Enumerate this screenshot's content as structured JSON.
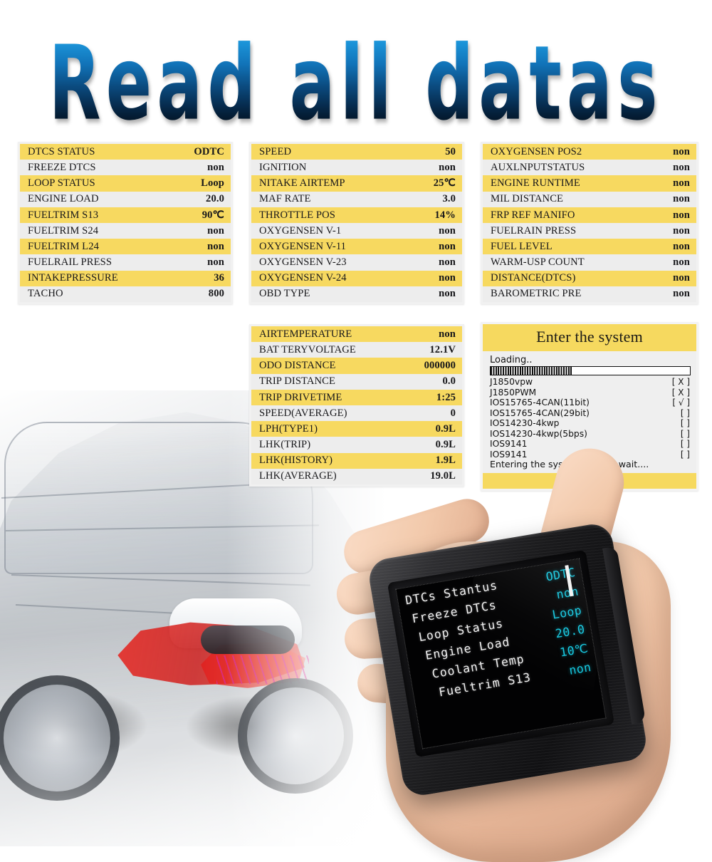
{
  "title": "Read all datas",
  "tables": [
    {
      "id": "table-1",
      "rows": [
        {
          "k": "DTCS STATUS",
          "v": "ODTC"
        },
        {
          "k": "FREEZE DTCS",
          "v": "non"
        },
        {
          "k": "LOOP STATUS",
          "v": "Loop"
        },
        {
          "k": "ENGINE LOAD",
          "v": "20.0"
        },
        {
          "k": "FUELTRIM S13",
          "v": "90℃"
        },
        {
          "k": "FUELTRIM S24",
          "v": "non"
        },
        {
          "k": "FUELTRIM L24",
          "v": "non"
        },
        {
          "k": "FUELRAIL PRESS",
          "v": "non"
        },
        {
          "k": "INTAKEPRESSURE",
          "v": "36"
        },
        {
          "k": "TACHO",
          "v": "800"
        }
      ]
    },
    {
      "id": "table-2",
      "rows": [
        {
          "k": "SPEED",
          "v": "50"
        },
        {
          "k": "IGNITION",
          "v": "non"
        },
        {
          "k": "NITAKE AIRTEMP",
          "v": "25℃"
        },
        {
          "k": "MAF RATE",
          "v": "3.0"
        },
        {
          "k": "THROTTLE POS",
          "v": "14%"
        },
        {
          "k": "OXYGENSEN V-1",
          "v": "non"
        },
        {
          "k": "OXYGENSEN V-11",
          "v": "non"
        },
        {
          "k": "OXYGENSEN V-23",
          "v": "non"
        },
        {
          "k": "OXYGENSEN V-24",
          "v": "non"
        },
        {
          "k": "OBD TYPE",
          "v": "non"
        }
      ]
    },
    {
      "id": "table-3",
      "rows": [
        {
          "k": "OXYGENSEN POS2",
          "v": "non"
        },
        {
          "k": "AUXLNPUTSTATUS",
          "v": "non"
        },
        {
          "k": "ENGINE RUNTIME",
          "v": "non"
        },
        {
          "k": "MIL DISTANCE",
          "v": "non"
        },
        {
          "k": "FRP REF MANIFO",
          "v": "non"
        },
        {
          "k": "FUELRAIN PRESS",
          "v": "non"
        },
        {
          "k": "FUEL LEVEL",
          "v": "non"
        },
        {
          "k": "WARM-USP COUNT",
          "v": "non"
        },
        {
          "k": "DISTANCE(DTCS)",
          "v": "non"
        },
        {
          "k": "BAROMETRIC PRE",
          "v": "non"
        }
      ]
    },
    {
      "id": "table-4",
      "rows": [
        {
          "k": "AIRTEMPERATURE",
          "v": "non"
        },
        {
          "k": "BAT TERYVOLTAGE",
          "v": "12.1V"
        },
        {
          "k": "ODO DISTANCE",
          "v": "000000"
        },
        {
          "k": "TRIP DISTANCE",
          "v": "0.0"
        },
        {
          "k": "TRIP DRIVETIME",
          "v": "1:25"
        },
        {
          "k": "SPEED(AVERAGE)",
          "v": "0"
        },
        {
          "k": "LPH(TYPE1)",
          "v": "0.9L"
        },
        {
          "k": "LHK(TRIP)",
          "v": "0.9L"
        },
        {
          "k": "LHK(HISTORY)",
          "v": "1.9L"
        },
        {
          "k": "LHK(AVERAGE)",
          "v": "19.0L"
        }
      ]
    }
  ],
  "enter_system": {
    "header": "Enter the system",
    "loading_label": "Loading..",
    "progress_percent": 41,
    "protocols": [
      {
        "name": "J1850vpw",
        "flag": "[ X ]"
      },
      {
        "name": "J1850PWM",
        "flag": "[ X ]"
      },
      {
        "name": "IOS15765-4CAN(11bit)",
        "flag": "[ √ ]"
      },
      {
        "name": "IOS15765-4CAN(29bit)",
        "flag": "[ ]"
      },
      {
        "name": "IOS14230-4kwp",
        "flag": "[ ]"
      },
      {
        "name": "IOS14230-4kwp(5bps)",
        "flag": "[ ]"
      },
      {
        "name": "IOS9141",
        "flag": "[ ]"
      },
      {
        "name": "IOS9141",
        "flag": "[ ]"
      }
    ],
    "wait_message": "Entering the system, please wait...."
  },
  "device_screen": {
    "rows": [
      {
        "lbl": "DTCs  Stantus",
        "val": "ODTC"
      },
      {
        "lbl": "Freeze DTCs",
        "val": "non"
      },
      {
        "lbl": "Loop  Status",
        "val": "Loop"
      },
      {
        "lbl": "Engine Load",
        "val": "20.0"
      },
      {
        "lbl": "Coolant  Temp",
        "val": "10℃"
      },
      {
        "lbl": "Fueltrim S13",
        "val": "non"
      }
    ]
  },
  "colors": {
    "row_highlight": "#f7d960",
    "row_alt": "#ededed",
    "panel_header": "#f6d95f",
    "screen_value": "#14c8e0",
    "title_top": "#2fa9e8",
    "title_bottom": "#000000"
  }
}
